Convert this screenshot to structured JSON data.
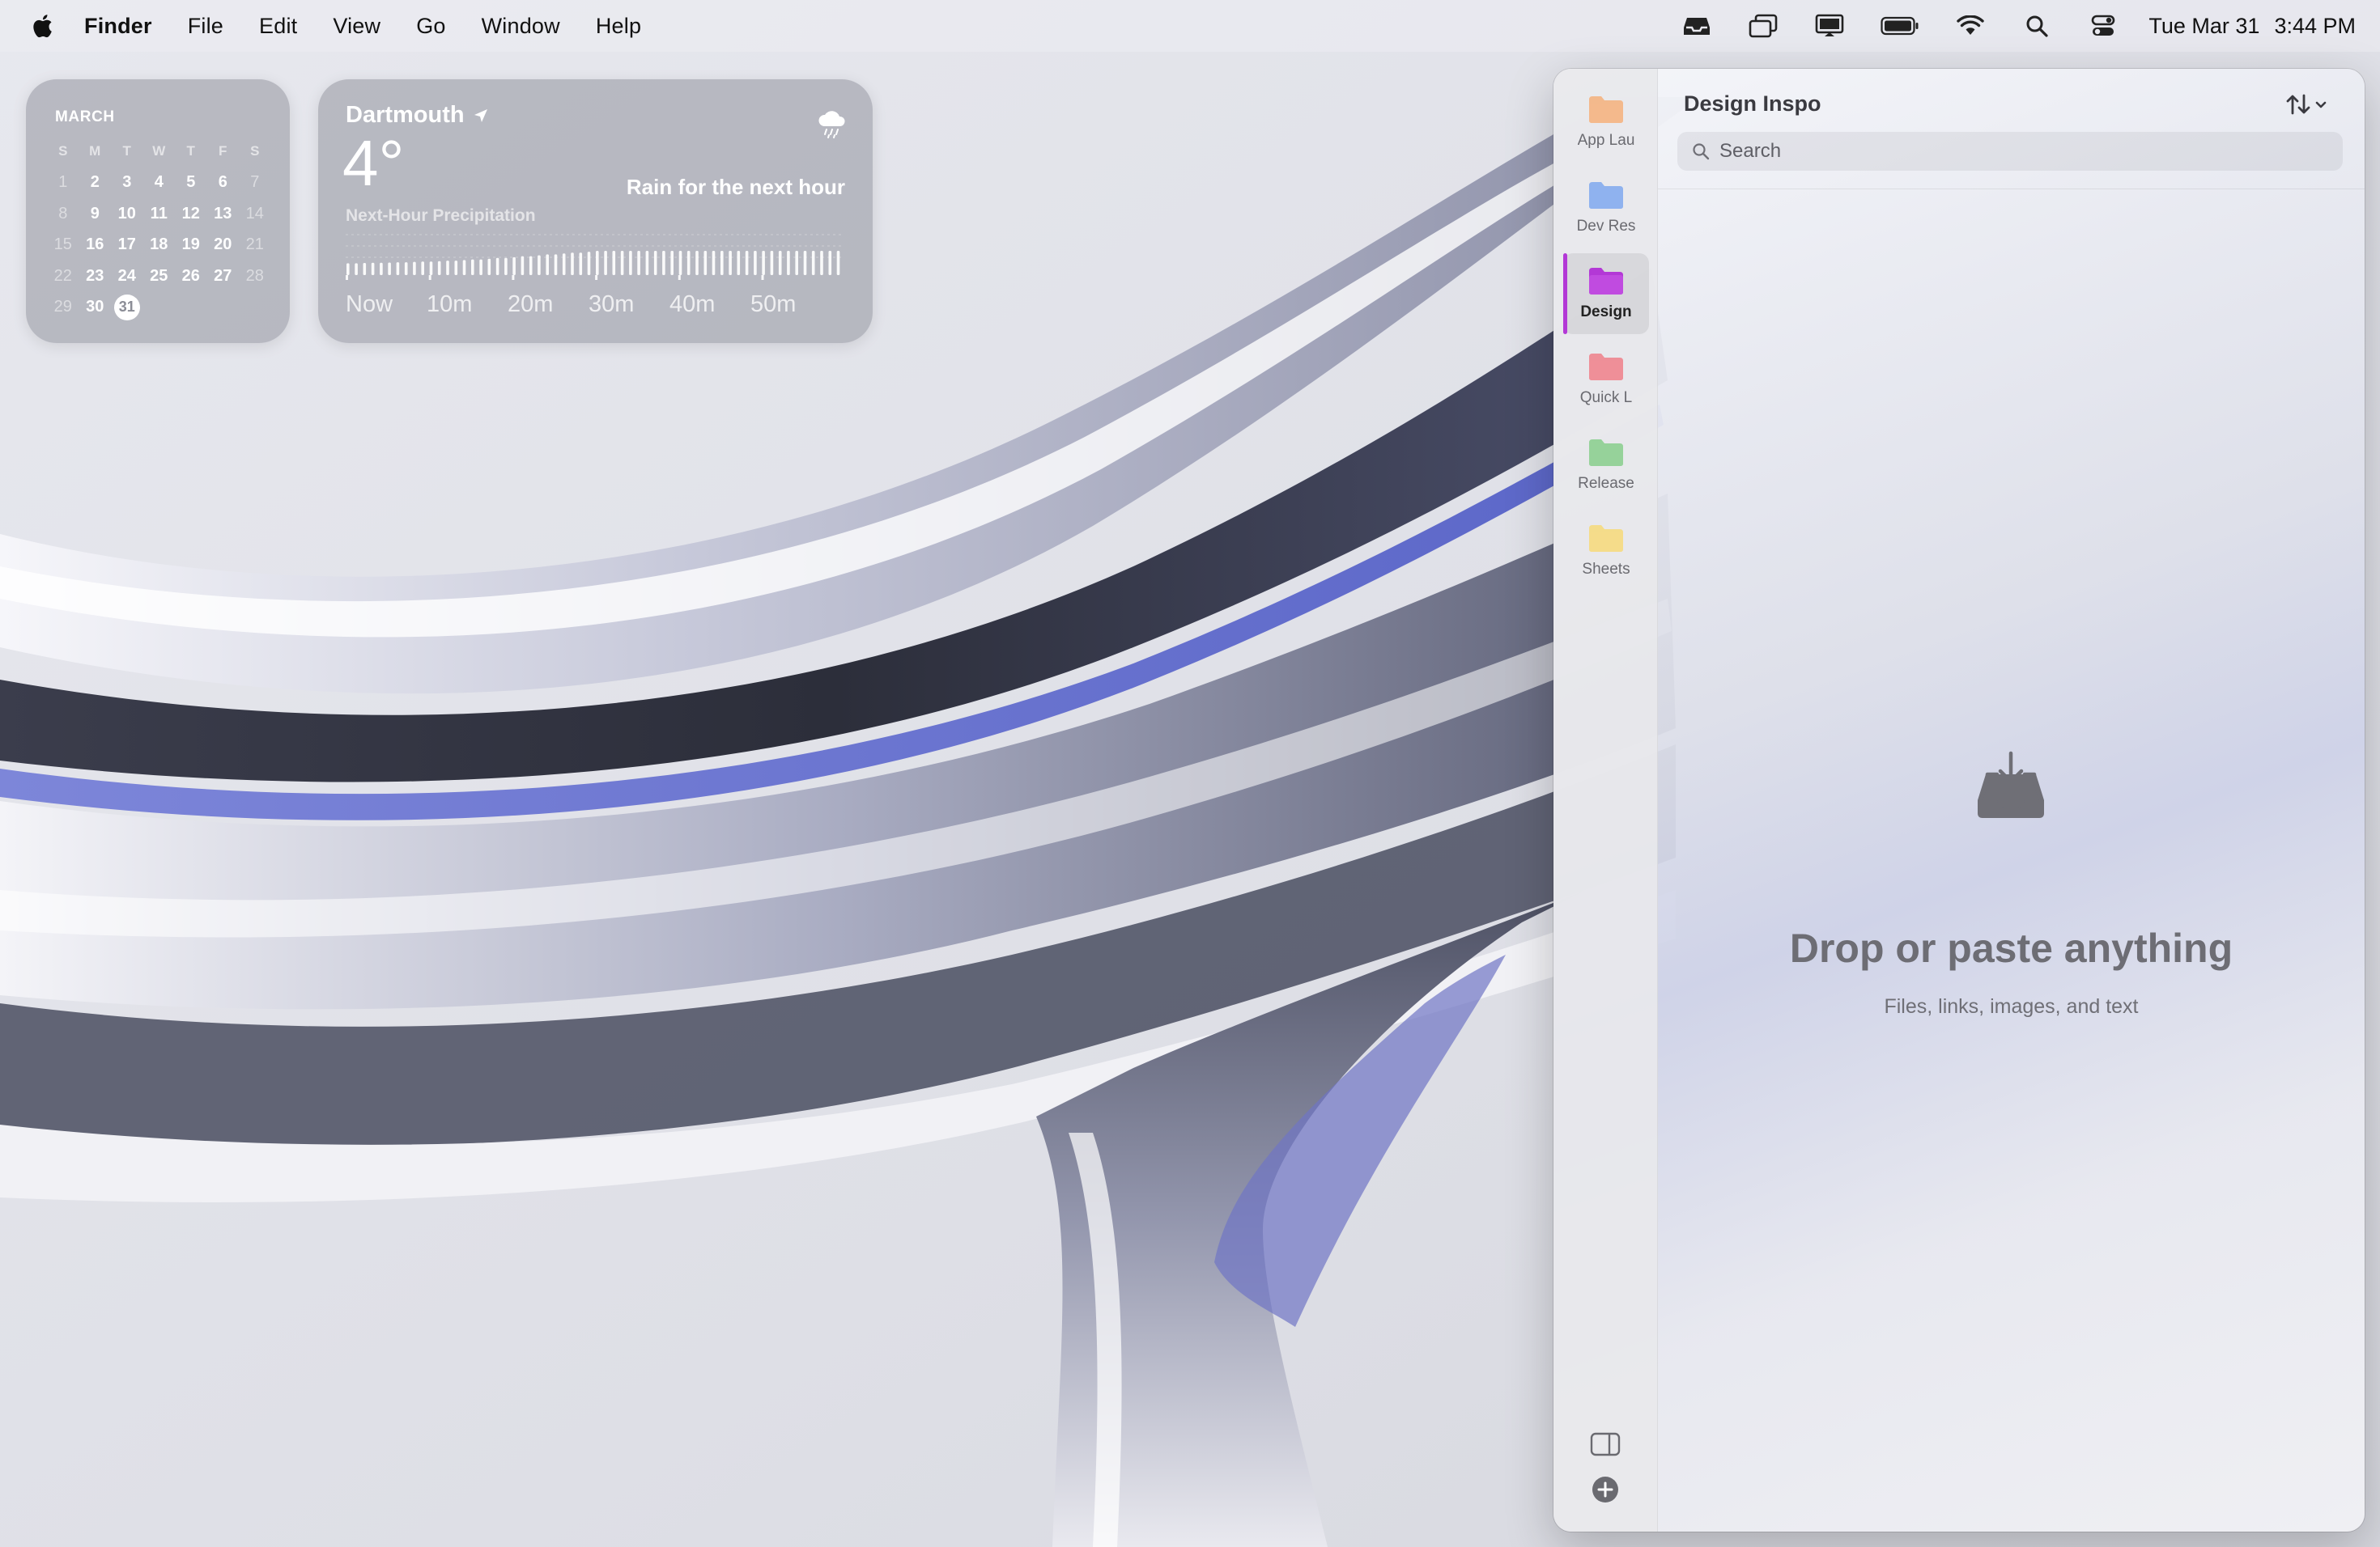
{
  "menubar": {
    "app_name": "Finder",
    "items": [
      "File",
      "Edit",
      "View",
      "Go",
      "Window",
      "Help"
    ],
    "status_icons": [
      "inbox-tray-icon",
      "window-stack-icon",
      "display-icon",
      "battery-icon",
      "wifi-icon",
      "spotlight-search-icon",
      "control-center-icon"
    ],
    "date": "Tue Mar 31",
    "time": "3:44 PM"
  },
  "calendar_widget": {
    "month": "MARCH",
    "weekdays": [
      "S",
      "M",
      "T",
      "W",
      "T",
      "F",
      "S"
    ],
    "weeks": [
      [
        "1",
        "2",
        "3",
        "4",
        "5",
        "6",
        "7"
      ],
      [
        "8",
        "9",
        "10",
        "11",
        "12",
        "13",
        "14"
      ],
      [
        "15",
        "16",
        "17",
        "18",
        "19",
        "20",
        "21"
      ],
      [
        "22",
        "23",
        "24",
        "25",
        "26",
        "27",
        "28"
      ],
      [
        "29",
        "30",
        "31",
        "",
        "",
        "",
        ""
      ]
    ],
    "today": "31"
  },
  "weather_widget": {
    "location": "Dartmouth",
    "temperature": "4°",
    "condition": "Rain for the next hour",
    "subtitle": "Next-Hour Precipitation",
    "time_labels": [
      "Now",
      "10m",
      "20m",
      "30m",
      "40m",
      "50m"
    ],
    "precip_intensity": [
      0.3,
      0.32,
      0.33,
      0.34,
      0.36,
      0.38,
      0.4,
      0.42,
      0.45,
      0.48,
      0.52,
      0.56,
      0.6,
      0.64,
      0.7,
      0.75,
      0.8,
      0.85,
      0.9,
      0.95,
      1,
      1,
      1,
      1,
      1,
      1,
      1,
      1,
      1,
      1,
      1,
      1,
      1,
      1,
      1,
      1,
      1,
      1,
      1,
      1
    ]
  },
  "app_window": {
    "title": "Design Inspo",
    "search_placeholder": "Search",
    "empty_title": "Drop or paste anything",
    "empty_subtitle": "Files, links, images, and text",
    "sidebar_items": [
      {
        "label": "App Lau",
        "color": "#f3b98c"
      },
      {
        "label": "Dev Res",
        "color": "#8fb2ee"
      },
      {
        "label": "Design",
        "color": "#b338d6",
        "active": true
      },
      {
        "label": "Quick L",
        "color": "#ee8f98"
      },
      {
        "label": "Release",
        "color": "#96d29a"
      },
      {
        "label": "Sheets",
        "color": "#f4dc8a"
      }
    ]
  }
}
